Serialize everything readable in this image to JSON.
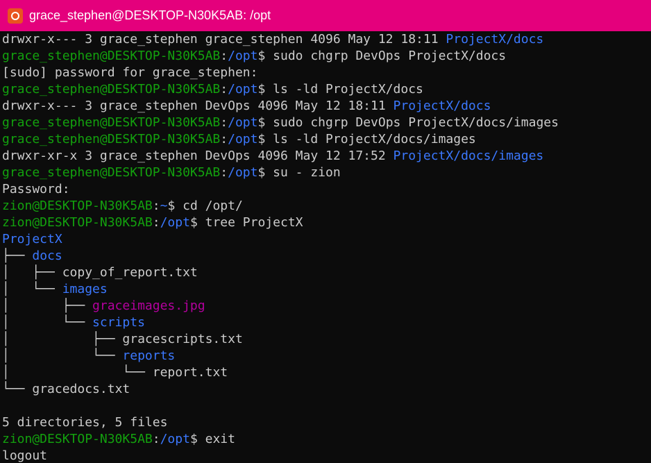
{
  "window": {
    "title": "grace_stephen@DESKTOP-N30K5AB: /opt",
    "icon": "ubuntu-icon",
    "titlebar_color": "#e4007c"
  },
  "colors": {
    "background": "#0c0c0c",
    "text": "#cccccc",
    "prompt": "#13a10e",
    "directory": "#3b78ff",
    "image_file": "#b4009e"
  },
  "lines": [
    [
      {
        "t": "drwxr-x--- 3 grace_stephen grace_stephen 4096 May 12 18:11 ",
        "c": "c-white"
      },
      {
        "t": "ProjectX/docs",
        "c": "c-blue"
      }
    ],
    [
      {
        "t": "grace_stephen@DESKTOP-N30K5AB",
        "c": "c-green"
      },
      {
        "t": ":",
        "c": "c-white"
      },
      {
        "t": "/opt",
        "c": "c-blue"
      },
      {
        "t": "$ sudo chgrp DevOps ProjectX/docs",
        "c": "c-white"
      }
    ],
    [
      {
        "t": "[sudo] password for grace_stephen:",
        "c": "c-white"
      }
    ],
    [
      {
        "t": "grace_stephen@DESKTOP-N30K5AB",
        "c": "c-green"
      },
      {
        "t": ":",
        "c": "c-white"
      },
      {
        "t": "/opt",
        "c": "c-blue"
      },
      {
        "t": "$ ls -ld ProjectX/docs",
        "c": "c-white"
      }
    ],
    [
      {
        "t": "drwxr-x--- 3 grace_stephen DevOps 4096 May 12 18:11 ",
        "c": "c-white"
      },
      {
        "t": "ProjectX/docs",
        "c": "c-blue"
      }
    ],
    [
      {
        "t": "grace_stephen@DESKTOP-N30K5AB",
        "c": "c-green"
      },
      {
        "t": ":",
        "c": "c-white"
      },
      {
        "t": "/opt",
        "c": "c-blue"
      },
      {
        "t": "$ sudo chgrp DevOps ProjectX/docs/images",
        "c": "c-white"
      }
    ],
    [
      {
        "t": "grace_stephen@DESKTOP-N30K5AB",
        "c": "c-green"
      },
      {
        "t": ":",
        "c": "c-white"
      },
      {
        "t": "/opt",
        "c": "c-blue"
      },
      {
        "t": "$ ls -ld ProjectX/docs/images",
        "c": "c-white"
      }
    ],
    [
      {
        "t": "drwxr-xr-x 3 grace_stephen DevOps 4096 May 12 17:52 ",
        "c": "c-white"
      },
      {
        "t": "ProjectX/docs/images",
        "c": "c-blue"
      }
    ],
    [
      {
        "t": "grace_stephen@DESKTOP-N30K5AB",
        "c": "c-green"
      },
      {
        "t": ":",
        "c": "c-white"
      },
      {
        "t": "/opt",
        "c": "c-blue"
      },
      {
        "t": "$ su - zion",
        "c": "c-white"
      }
    ],
    [
      {
        "t": "Password:",
        "c": "c-white"
      }
    ],
    [
      {
        "t": "zion@DESKTOP-N30K5AB",
        "c": "c-green"
      },
      {
        "t": ":",
        "c": "c-white"
      },
      {
        "t": "~",
        "c": "c-blue"
      },
      {
        "t": "$ cd /opt/",
        "c": "c-white"
      }
    ],
    [
      {
        "t": "zion@DESKTOP-N30K5AB",
        "c": "c-green"
      },
      {
        "t": ":",
        "c": "c-white"
      },
      {
        "t": "/opt",
        "c": "c-blue"
      },
      {
        "t": "$ tree ProjectX",
        "c": "c-white"
      }
    ],
    [
      {
        "t": "ProjectX",
        "c": "c-blue"
      }
    ],
    [
      {
        "t": "├── ",
        "c": "c-white"
      },
      {
        "t": "docs",
        "c": "c-blue"
      }
    ],
    [
      {
        "t": "│   ├── ",
        "c": "c-white"
      },
      {
        "t": "copy_of_report.txt",
        "c": "c-white"
      }
    ],
    [
      {
        "t": "│   └── ",
        "c": "c-white"
      },
      {
        "t": "images",
        "c": "c-blue"
      }
    ],
    [
      {
        "t": "│       ├── ",
        "c": "c-white"
      },
      {
        "t": "graceimages.jpg",
        "c": "c-purple"
      }
    ],
    [
      {
        "t": "│       └── ",
        "c": "c-white"
      },
      {
        "t": "scripts",
        "c": "c-blue"
      }
    ],
    [
      {
        "t": "│           ├── ",
        "c": "c-white"
      },
      {
        "t": "gracescripts.txt",
        "c": "c-white"
      }
    ],
    [
      {
        "t": "│           └── ",
        "c": "c-white"
      },
      {
        "t": "reports",
        "c": "c-blue"
      }
    ],
    [
      {
        "t": "│               └── ",
        "c": "c-white"
      },
      {
        "t": "report.txt",
        "c": "c-white"
      }
    ],
    [
      {
        "t": "└── ",
        "c": "c-white"
      },
      {
        "t": "gracedocs.txt",
        "c": "c-white"
      }
    ],
    [
      {
        "t": "",
        "c": "c-white"
      }
    ],
    [
      {
        "t": "5 directories, 5 files",
        "c": "c-white"
      }
    ],
    [
      {
        "t": "zion@DESKTOP-N30K5AB",
        "c": "c-green"
      },
      {
        "t": ":",
        "c": "c-white"
      },
      {
        "t": "/opt",
        "c": "c-blue"
      },
      {
        "t": "$ exit",
        "c": "c-white"
      }
    ],
    [
      {
        "t": "logout",
        "c": "c-white"
      }
    ]
  ]
}
